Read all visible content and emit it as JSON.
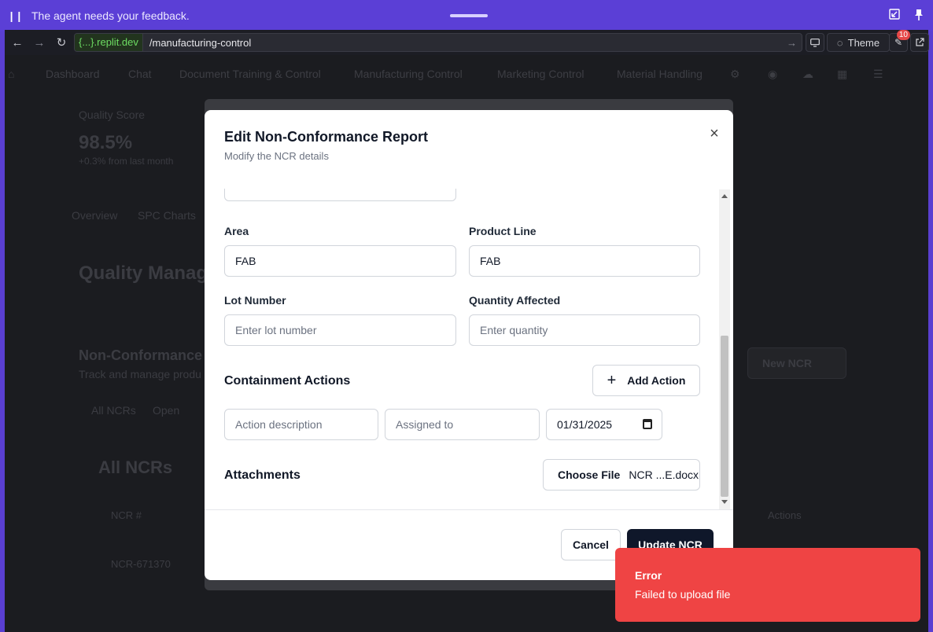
{
  "agent_bar": {
    "pause_icon": "pause-icon",
    "message": "The agent needs your feedback."
  },
  "browser": {
    "domain": "{...}.replit.dev",
    "path": "/manufacturing-control",
    "theme_label": "Theme",
    "badge_count": "10"
  },
  "app": {
    "nav": [
      "Dashboard",
      "Chat",
      "Document Training & Control",
      "Manufacturing Control",
      "Marketing Control",
      "Material Handling"
    ],
    "quality_score_label": "Quality Score",
    "quality_score_value": "98.5%",
    "quality_score_note": "+0.3% from last month",
    "tabs": [
      "Overview",
      "SPC Charts"
    ],
    "quality_heading": "Quality Manage",
    "ncr_heading": "Non-Conformance",
    "ncr_sub": "Track and manage produ",
    "filters": [
      "All NCRs",
      "Open"
    ],
    "new_ncr": "New NCR",
    "all_ncrs": "All NCRs",
    "col_ncr": "NCR #",
    "col_actions": "Actions",
    "row_ncr": "NCR-671370"
  },
  "modal": {
    "title": "Edit Non-Conformance Report",
    "subtitle": "Modify the NCR details",
    "area_label": "Area",
    "area_value": "FAB",
    "product_line_label": "Product Line",
    "product_line_value": "FAB",
    "lot_label": "Lot Number",
    "lot_placeholder": "Enter lot number",
    "qty_label": "Quantity Affected",
    "qty_placeholder": "Enter quantity",
    "containment_title": "Containment Actions",
    "add_action": "Add Action",
    "action_desc_placeholder": "Action description",
    "assigned_placeholder": "Assigned to",
    "date_value": "01/31/2025",
    "attachments_title": "Attachments",
    "choose_file": "Choose File",
    "file_name": "NCR ...E.docx",
    "cancel": "Cancel",
    "update": "Update NCR"
  },
  "toast": {
    "title": "Error",
    "description": "Failed to upload file"
  },
  "colors": {
    "agent_bar": "#5b3fd6",
    "toast_bg": "#ef4444",
    "primary_button": "#0f172a"
  }
}
